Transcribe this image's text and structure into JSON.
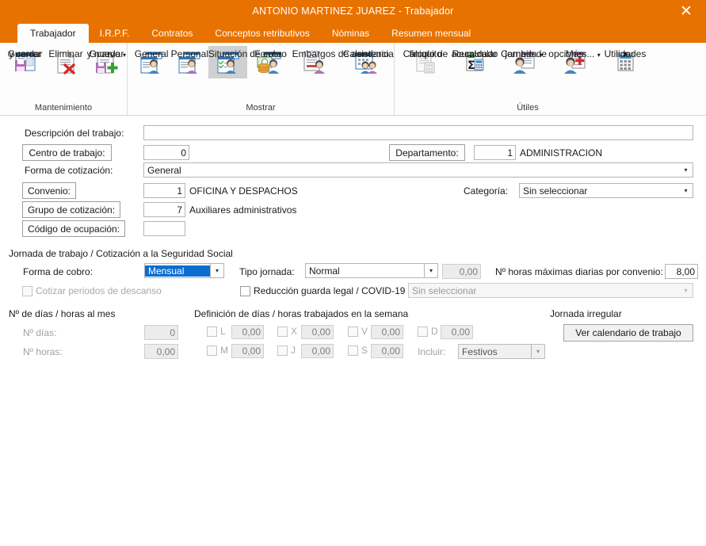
{
  "window": {
    "title": "ANTONIO MARTINEZ JUAREZ - Trabajador",
    "close_label": "✕",
    "accent_color": "#e87200"
  },
  "tabs": [
    {
      "label": "Trabajador",
      "active": true
    },
    {
      "label": "I.R.P.F.",
      "active": false
    },
    {
      "label": "Contratos",
      "active": false
    },
    {
      "label": "Conceptos retributivos",
      "active": false
    },
    {
      "label": "Nóminas",
      "active": false
    },
    {
      "label": "Resumen mensual",
      "active": false
    }
  ],
  "ribbon": {
    "groups": [
      {
        "label": "Mantenimiento",
        "items": [
          {
            "label1": "Guardar",
            "label2": "y cerrar",
            "icon": "save-close-icon",
            "disabled": false,
            "selected": false,
            "caret": false
          },
          {
            "label1": "Eliminar",
            "label2": "",
            "icon": "delete-icon",
            "disabled": false,
            "selected": false,
            "caret": false
          },
          {
            "label1": "Guardar",
            "label2": "y nuevo",
            "icon": "save-new-icon",
            "disabled": false,
            "selected": false,
            "caret": true
          }
        ]
      },
      {
        "label": "Mostrar",
        "items": [
          {
            "label1": "General",
            "label2": "",
            "icon": "general-person-icon",
            "disabled": false,
            "selected": false,
            "caret": false
          },
          {
            "label1": "Personal",
            "label2": "",
            "icon": "personal-person-icon",
            "disabled": false,
            "selected": false,
            "caret": false
          },
          {
            "label1": "Situación",
            "label2": "",
            "icon": "situation-person-icon",
            "disabled": false,
            "selected": true,
            "caret": false
          },
          {
            "label1": "Forma",
            "label2": "de cobro",
            "icon": "payment-coins-icon",
            "disabled": false,
            "selected": false,
            "caret": false
          },
          {
            "label1": "Embargos",
            "label2": "",
            "icon": "garnishment-icon",
            "disabled": false,
            "selected": false,
            "caret": false
          },
          {
            "label1": "Calendario",
            "label2": "de asistencia",
            "icon": "attendance-calendar-icon",
            "disabled": false,
            "selected": false,
            "caret": false
          }
        ]
      },
      {
        "label": "Útiles",
        "items": [
          {
            "label1": "Cálculo de",
            "label2": "finiquito",
            "icon": "settlement-calc-icon",
            "disabled": true,
            "selected": false,
            "caret": false
          },
          {
            "label1": "Recalcular",
            "label2": "acumulado",
            "icon": "recalculate-sum-icon",
            "disabled": false,
            "selected": false,
            "caret": false
          },
          {
            "label1": "Cambio de",
            "label2": "jornada",
            "icon": "workday-change-icon",
            "disabled": false,
            "selected": false,
            "caret": true
          },
          {
            "label1": "Más",
            "label2": "opciones...",
            "icon": "more-options-icon",
            "disabled": false,
            "selected": false,
            "caret": true
          },
          {
            "label1": "Utilidades",
            "label2": "",
            "icon": "utilities-calculator-icon",
            "disabled": false,
            "selected": false,
            "caret": true
          }
        ]
      }
    ]
  },
  "form": {
    "descripcion_label": "Descripción del trabajo:",
    "descripcion_value": "",
    "centro_label": "Centro de trabajo:",
    "centro_value": "0",
    "departamento_label": "Departamento:",
    "departamento_value": "1",
    "departamento_text": "ADMINISTRACION",
    "forma_cotizacion_label": "Forma de cotización:",
    "forma_cotizacion_value": "General",
    "convenio_label": "Convenio:",
    "convenio_value": "1",
    "convenio_text": "OFICINA Y DESPACHOS",
    "categoria_label": "Categoría:",
    "categoria_value": "Sin seleccionar",
    "grupo_label": "Grupo de cotización:",
    "grupo_value": "7",
    "grupo_text": "Auxiliares administrativos",
    "codigo_ocupacion_label": "Código de ocupación:",
    "codigo_ocupacion_value": "",
    "jornada_section_title": "Jornada de trabajo / Cotización a la Seguridad Social",
    "forma_cobro_label": "Forma de cobro:",
    "forma_cobro_value": "Mensual",
    "tipo_jornada_label": "Tipo jornada:",
    "tipo_jornada_value": "Normal",
    "tipo_jornada_pct": "0,00",
    "horas_maximas_label": "Nº horas máximas diarias por convenio:",
    "horas_maximas_value": "8,00",
    "cotizar_descanso_label": "Cotizar periodos de descanso",
    "cotizar_descanso_checked": false,
    "reduccion_label": "Reducción guarda legal / COVID-19",
    "reduccion_checked": false,
    "reduccion_select_value": "Sin seleccionar",
    "dias_mes_title": "Nº de días / horas al mes",
    "n_dias_label": "Nº días:",
    "n_dias_value": "0",
    "n_horas_label": "Nº horas:",
    "n_horas_value": "0,00",
    "semana_title": "Definición de días / horas trabajados en la semana",
    "dias_semana": [
      {
        "key": "L",
        "value": "0,00",
        "checked": false
      },
      {
        "key": "M",
        "value": "0,00",
        "checked": false
      },
      {
        "key": "X",
        "value": "0,00",
        "checked": false
      },
      {
        "key": "J",
        "value": "0,00",
        "checked": false
      },
      {
        "key": "V",
        "value": "0,00",
        "checked": false
      },
      {
        "key": "S",
        "value": "0,00",
        "checked": false
      }
    ],
    "domingo": {
      "key": "D",
      "value": "0,00",
      "checked": false
    },
    "incluir_label": "Incluir:",
    "incluir_value": "Festivos",
    "jornada_irregular_title": "Jornada irregular",
    "ver_calendario_label": "Ver calendario de trabajo"
  }
}
